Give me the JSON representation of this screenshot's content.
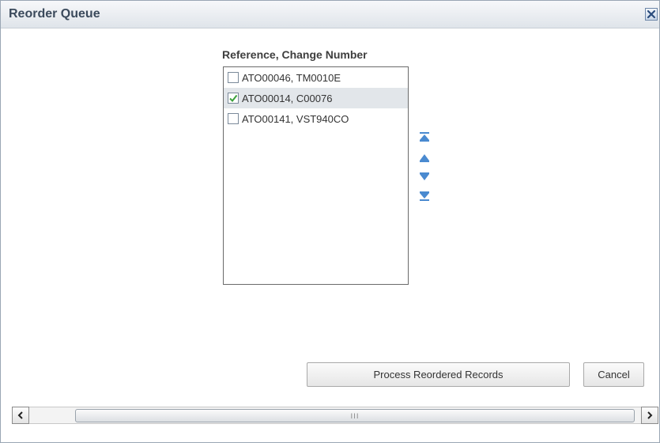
{
  "dialog": {
    "title": "Reorder Queue"
  },
  "list": {
    "header": "Reference, Change Number",
    "items": [
      {
        "label": "ATO00046, TM0010E",
        "checked": false
      },
      {
        "label": "ATO00014, C00076",
        "checked": true
      },
      {
        "label": "ATO00141, VST940CO",
        "checked": false
      }
    ]
  },
  "reorder_controls": {
    "icons": [
      "move-to-top-icon",
      "move-up-icon",
      "move-down-icon",
      "move-to-bottom-icon"
    ]
  },
  "buttons": {
    "process_label": "Process Reordered Records",
    "cancel_label": "Cancel"
  },
  "scrollbar": {
    "grip": "III"
  },
  "colors": {
    "accent": "#4a8ad0",
    "check": "#3aa13a",
    "title_text": "#3b4a5c"
  }
}
